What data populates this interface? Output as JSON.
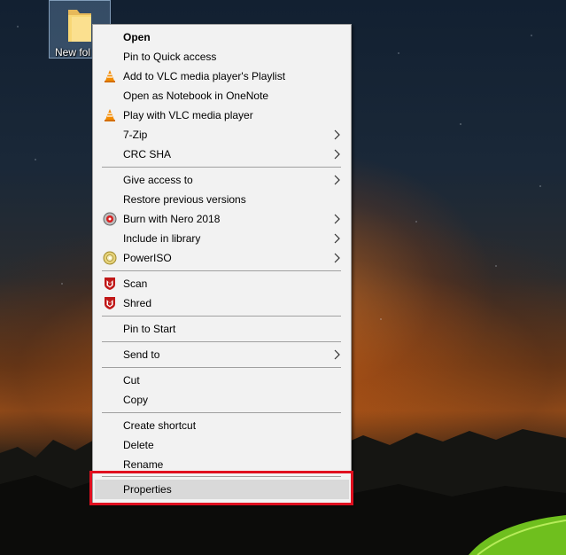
{
  "desktop": {
    "folder_label": "New fol"
  },
  "context_menu": {
    "items": [
      {
        "label": "Open"
      },
      {
        "label": "Pin to Quick access"
      },
      {
        "label": "Add to VLC media player's Playlist",
        "icon": "vlc-cone-icon"
      },
      {
        "label": "Open as Notebook in OneNote"
      },
      {
        "label": "Play with VLC media player",
        "icon": "vlc-cone-icon"
      },
      {
        "label": "7-Zip",
        "submenu": true
      },
      {
        "label": "CRC SHA",
        "submenu": true
      },
      {
        "label": "Give access to",
        "submenu": true
      },
      {
        "label": "Restore previous versions"
      },
      {
        "label": "Burn with Nero 2018",
        "icon": "nero-disc-icon",
        "submenu": true
      },
      {
        "label": "Include in library",
        "submenu": true
      },
      {
        "label": "PowerISO",
        "icon": "poweriso-disc-icon",
        "submenu": true
      },
      {
        "label": "Scan",
        "icon": "mcafee-shield-icon"
      },
      {
        "label": "Shred",
        "icon": "mcafee-shield-icon"
      },
      {
        "label": "Pin to Start"
      },
      {
        "label": "Send to",
        "submenu": true
      },
      {
        "label": "Cut"
      },
      {
        "label": "Copy"
      },
      {
        "label": "Create shortcut"
      },
      {
        "label": "Delete"
      },
      {
        "label": "Rename"
      },
      {
        "label": "Properties",
        "state": "hovered",
        "highlighted": true
      }
    ]
  },
  "colors": {
    "menu_background": "#f2f2f2",
    "hover_background": "#d9d9d9",
    "highlight_outline": "#e00f1f",
    "vlc_orange": "#f38b00",
    "mcafee_red": "#c01818"
  }
}
